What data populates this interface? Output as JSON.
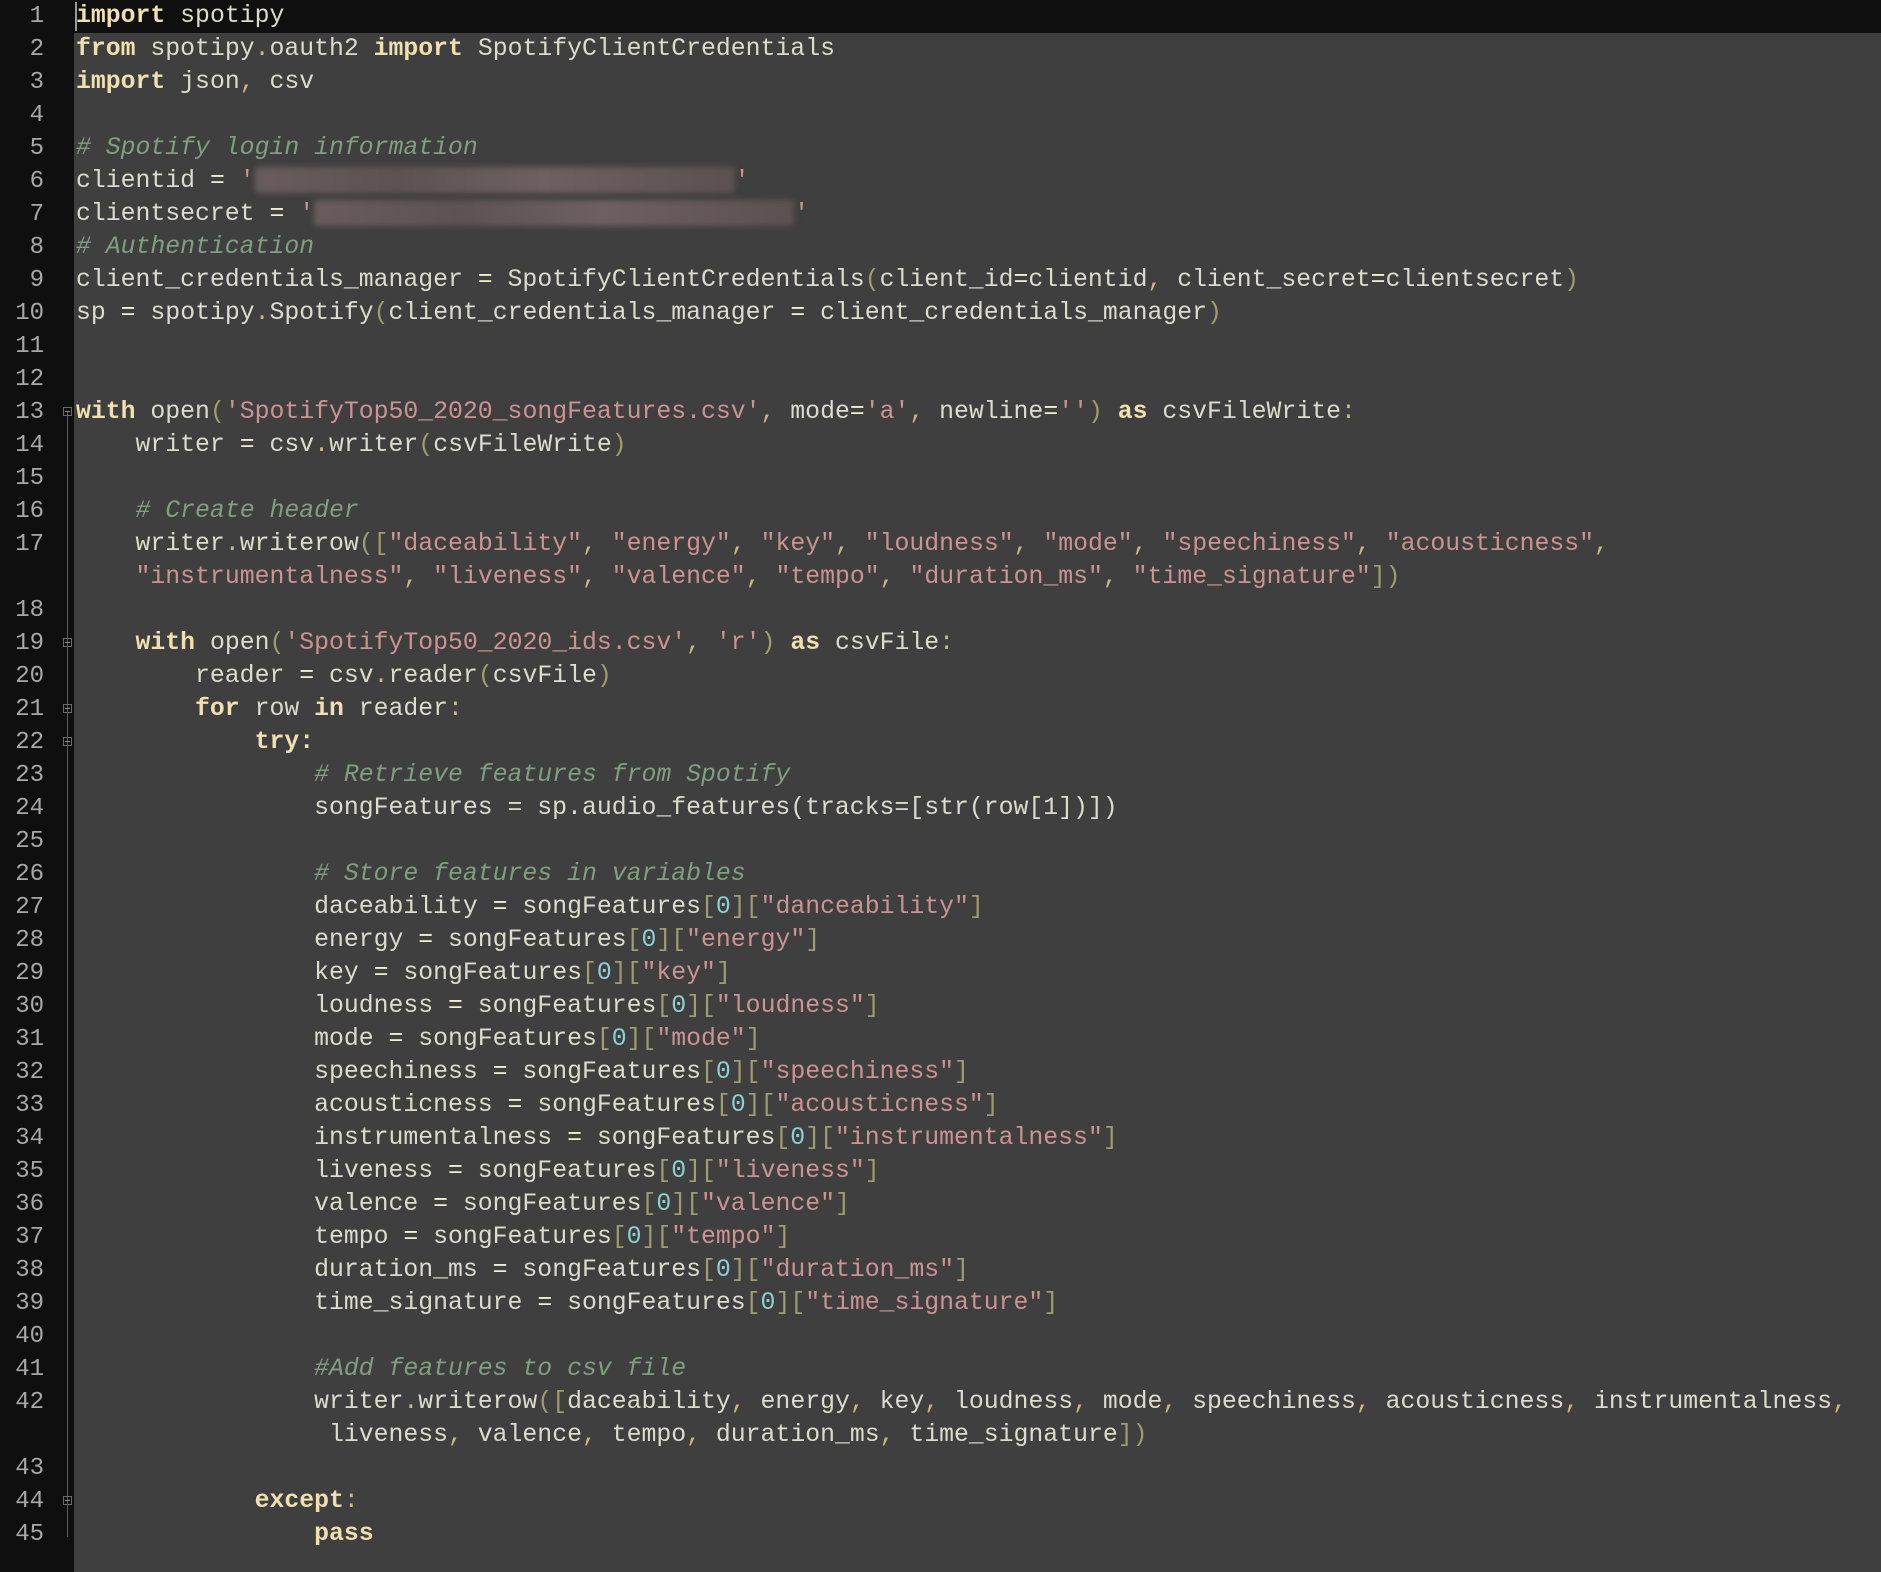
{
  "editor": {
    "lines": [
      {
        "n": "1",
        "text": "import spotipy"
      },
      {
        "n": "2",
        "text": "from spotipy.oauth2 import SpotifyClientCredentials"
      },
      {
        "n": "3",
        "text": "import json, csv"
      },
      {
        "n": "4",
        "text": ""
      },
      {
        "n": "5",
        "text": "# Spotify login information"
      },
      {
        "n": "6",
        "text": "clientid = '",
        "blurred": true,
        "tail": "'"
      },
      {
        "n": "7",
        "text": "clientsecret = '",
        "blurred": true,
        "tail": "'"
      },
      {
        "n": "8",
        "text": "# Authentication"
      },
      {
        "n": "9",
        "text": "client_credentials_manager = SpotifyClientCredentials(client_id=clientid, client_secret=clientsecret)"
      },
      {
        "n": "10",
        "text": "sp = spotipy.Spotify(client_credentials_manager = client_credentials_manager)"
      },
      {
        "n": "11",
        "text": ""
      },
      {
        "n": "12",
        "text": ""
      },
      {
        "n": "13",
        "text": "with open('SpotifyTop50_2020_songFeatures.csv', mode='a', newline='') as csvFileWrite:",
        "fold": true
      },
      {
        "n": "14",
        "text": "    writer = csv.writer(csvFileWrite)"
      },
      {
        "n": "15",
        "text": ""
      },
      {
        "n": "16",
        "text": "    # Create header"
      },
      {
        "n": "17",
        "text": "    writer.writerow([\"daceability\", \"energy\", \"key\", \"loudness\", \"mode\", \"speechiness\", \"acousticness\",",
        "cont": "    \"instrumentalness\", \"liveness\", \"valence\", \"tempo\", \"duration_ms\", \"time_signature\"])"
      },
      {
        "n": "18",
        "text": ""
      },
      {
        "n": "19",
        "text": "    with open('SpotifyTop50_2020_ids.csv', 'r') as csvFile:",
        "fold": true
      },
      {
        "n": "20",
        "text": "        reader = csv.reader(csvFile)"
      },
      {
        "n": "21",
        "text": "        for row in reader:",
        "fold": true
      },
      {
        "n": "22",
        "text": "            try:",
        "fold": true
      },
      {
        "n": "23",
        "text": "                # Retrieve features from Spotify"
      },
      {
        "n": "24",
        "text": "                songFeatures = sp.audio_features(tracks=[str(row[1])])"
      },
      {
        "n": "25",
        "text": ""
      },
      {
        "n": "26",
        "text": "                # Store features in variables"
      },
      {
        "n": "27",
        "text": "                daceability = songFeatures[0][\"danceability\"]"
      },
      {
        "n": "28",
        "text": "                energy = songFeatures[0][\"energy\"]"
      },
      {
        "n": "29",
        "text": "                key = songFeatures[0][\"key\"]"
      },
      {
        "n": "30",
        "text": "                loudness = songFeatures[0][\"loudness\"]"
      },
      {
        "n": "31",
        "text": "                mode = songFeatures[0][\"mode\"]"
      },
      {
        "n": "32",
        "text": "                speechiness = songFeatures[0][\"speechiness\"]"
      },
      {
        "n": "33",
        "text": "                acousticness = songFeatures[0][\"acousticness\"]"
      },
      {
        "n": "34",
        "text": "                instrumentalness = songFeatures[0][\"instrumentalness\"]"
      },
      {
        "n": "35",
        "text": "                liveness = songFeatures[0][\"liveness\"]"
      },
      {
        "n": "36",
        "text": "                valence = songFeatures[0][\"valence\"]"
      },
      {
        "n": "37",
        "text": "                tempo = songFeatures[0][\"tempo\"]"
      },
      {
        "n": "38",
        "text": "                duration_ms = songFeatures[0][\"duration_ms\"]"
      },
      {
        "n": "39",
        "text": "                time_signature = songFeatures[0][\"time_signature\"]"
      },
      {
        "n": "40",
        "text": ""
      },
      {
        "n": "41",
        "text": "                #Add features to csv file"
      },
      {
        "n": "42",
        "text": "                writer.writerow([daceability, energy, key, loudness, mode, speechiness, acousticness, instrumentalness,",
        "cont": "                 liveness, valence, tempo, duration_ms, time_signature])"
      },
      {
        "n": "43",
        "text": ""
      },
      {
        "n": "44",
        "text": "            except:",
        "fold": true
      },
      {
        "n": "45",
        "text": "                pass"
      }
    ]
  },
  "colors": {
    "background": "#3f3f3f",
    "gutter": "#0f0f0f",
    "keyword": "#f0dfaf",
    "string": "#cc9393",
    "comment": "#7f9f7f",
    "number": "#8cd0d3",
    "text": "#dcdccc"
  }
}
